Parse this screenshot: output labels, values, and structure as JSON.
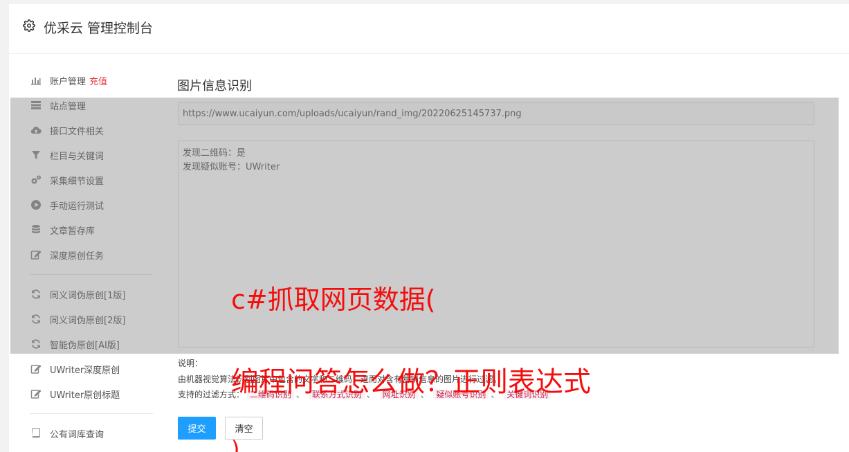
{
  "header": {
    "title": "优采云 管理控制台",
    "icon": "gear-icon"
  },
  "sidebar": {
    "items": [
      {
        "label": "账户管理",
        "badge": "充值",
        "icon": "bar-chart-icon"
      },
      {
        "label": "站点管理",
        "icon": "server-icon"
      },
      {
        "label": "接口文件相关",
        "icon": "cloud-upload-icon"
      },
      {
        "label": "栏目与关键词",
        "icon": "filter-icon"
      },
      {
        "label": "采集细节设置",
        "icon": "gears-icon"
      },
      {
        "label": "手动运行测试",
        "icon": "play-icon"
      },
      {
        "label": "文章暂存库",
        "icon": "database-icon"
      },
      {
        "label": "深度原创任务",
        "icon": "edit-icon"
      },
      {
        "label": "同义词伪原创[1版]",
        "icon": "refresh-icon"
      },
      {
        "label": "同义词伪原创[2版]",
        "icon": "refresh-icon"
      },
      {
        "label": "智能伪原创[AI版]",
        "icon": "refresh-icon"
      },
      {
        "label": "UWriter深度原创",
        "icon": "edit-icon"
      },
      {
        "label": "UWriter原创标题",
        "icon": "edit-icon"
      },
      {
        "label": "公有词库查询",
        "icon": "book-icon"
      }
    ]
  },
  "main": {
    "title": "图片信息识别",
    "url_value": "https://www.ucaiyun.com/uploads/ucaiyun/rand_img/20220625145737.png",
    "result_lines": [
      "发现二维码：是",
      "发现疑似账号：UWriter"
    ],
    "note_label": "说明：",
    "note_text": "由机器视觉算法识别图片中包含的文字和二维码，进而对含有营销信息的图片进行过滤。",
    "filter_label": "支持的过滤方式：",
    "filters": [
      "二维码识别",
      "联系方式识别",
      "网址识别",
      "疑似账号识别",
      "关键词识别"
    ],
    "submit_label": "提交",
    "clear_label": "清空"
  },
  "watermark": {
    "line1": "c#抓取网页数据(",
    "line2": "编程问答怎么做？正则表达式",
    "line3": ")"
  },
  "colors": {
    "primary": "#1e9fff",
    "accent_red": "#e4393c",
    "watermark_red": "#f50d0d"
  }
}
